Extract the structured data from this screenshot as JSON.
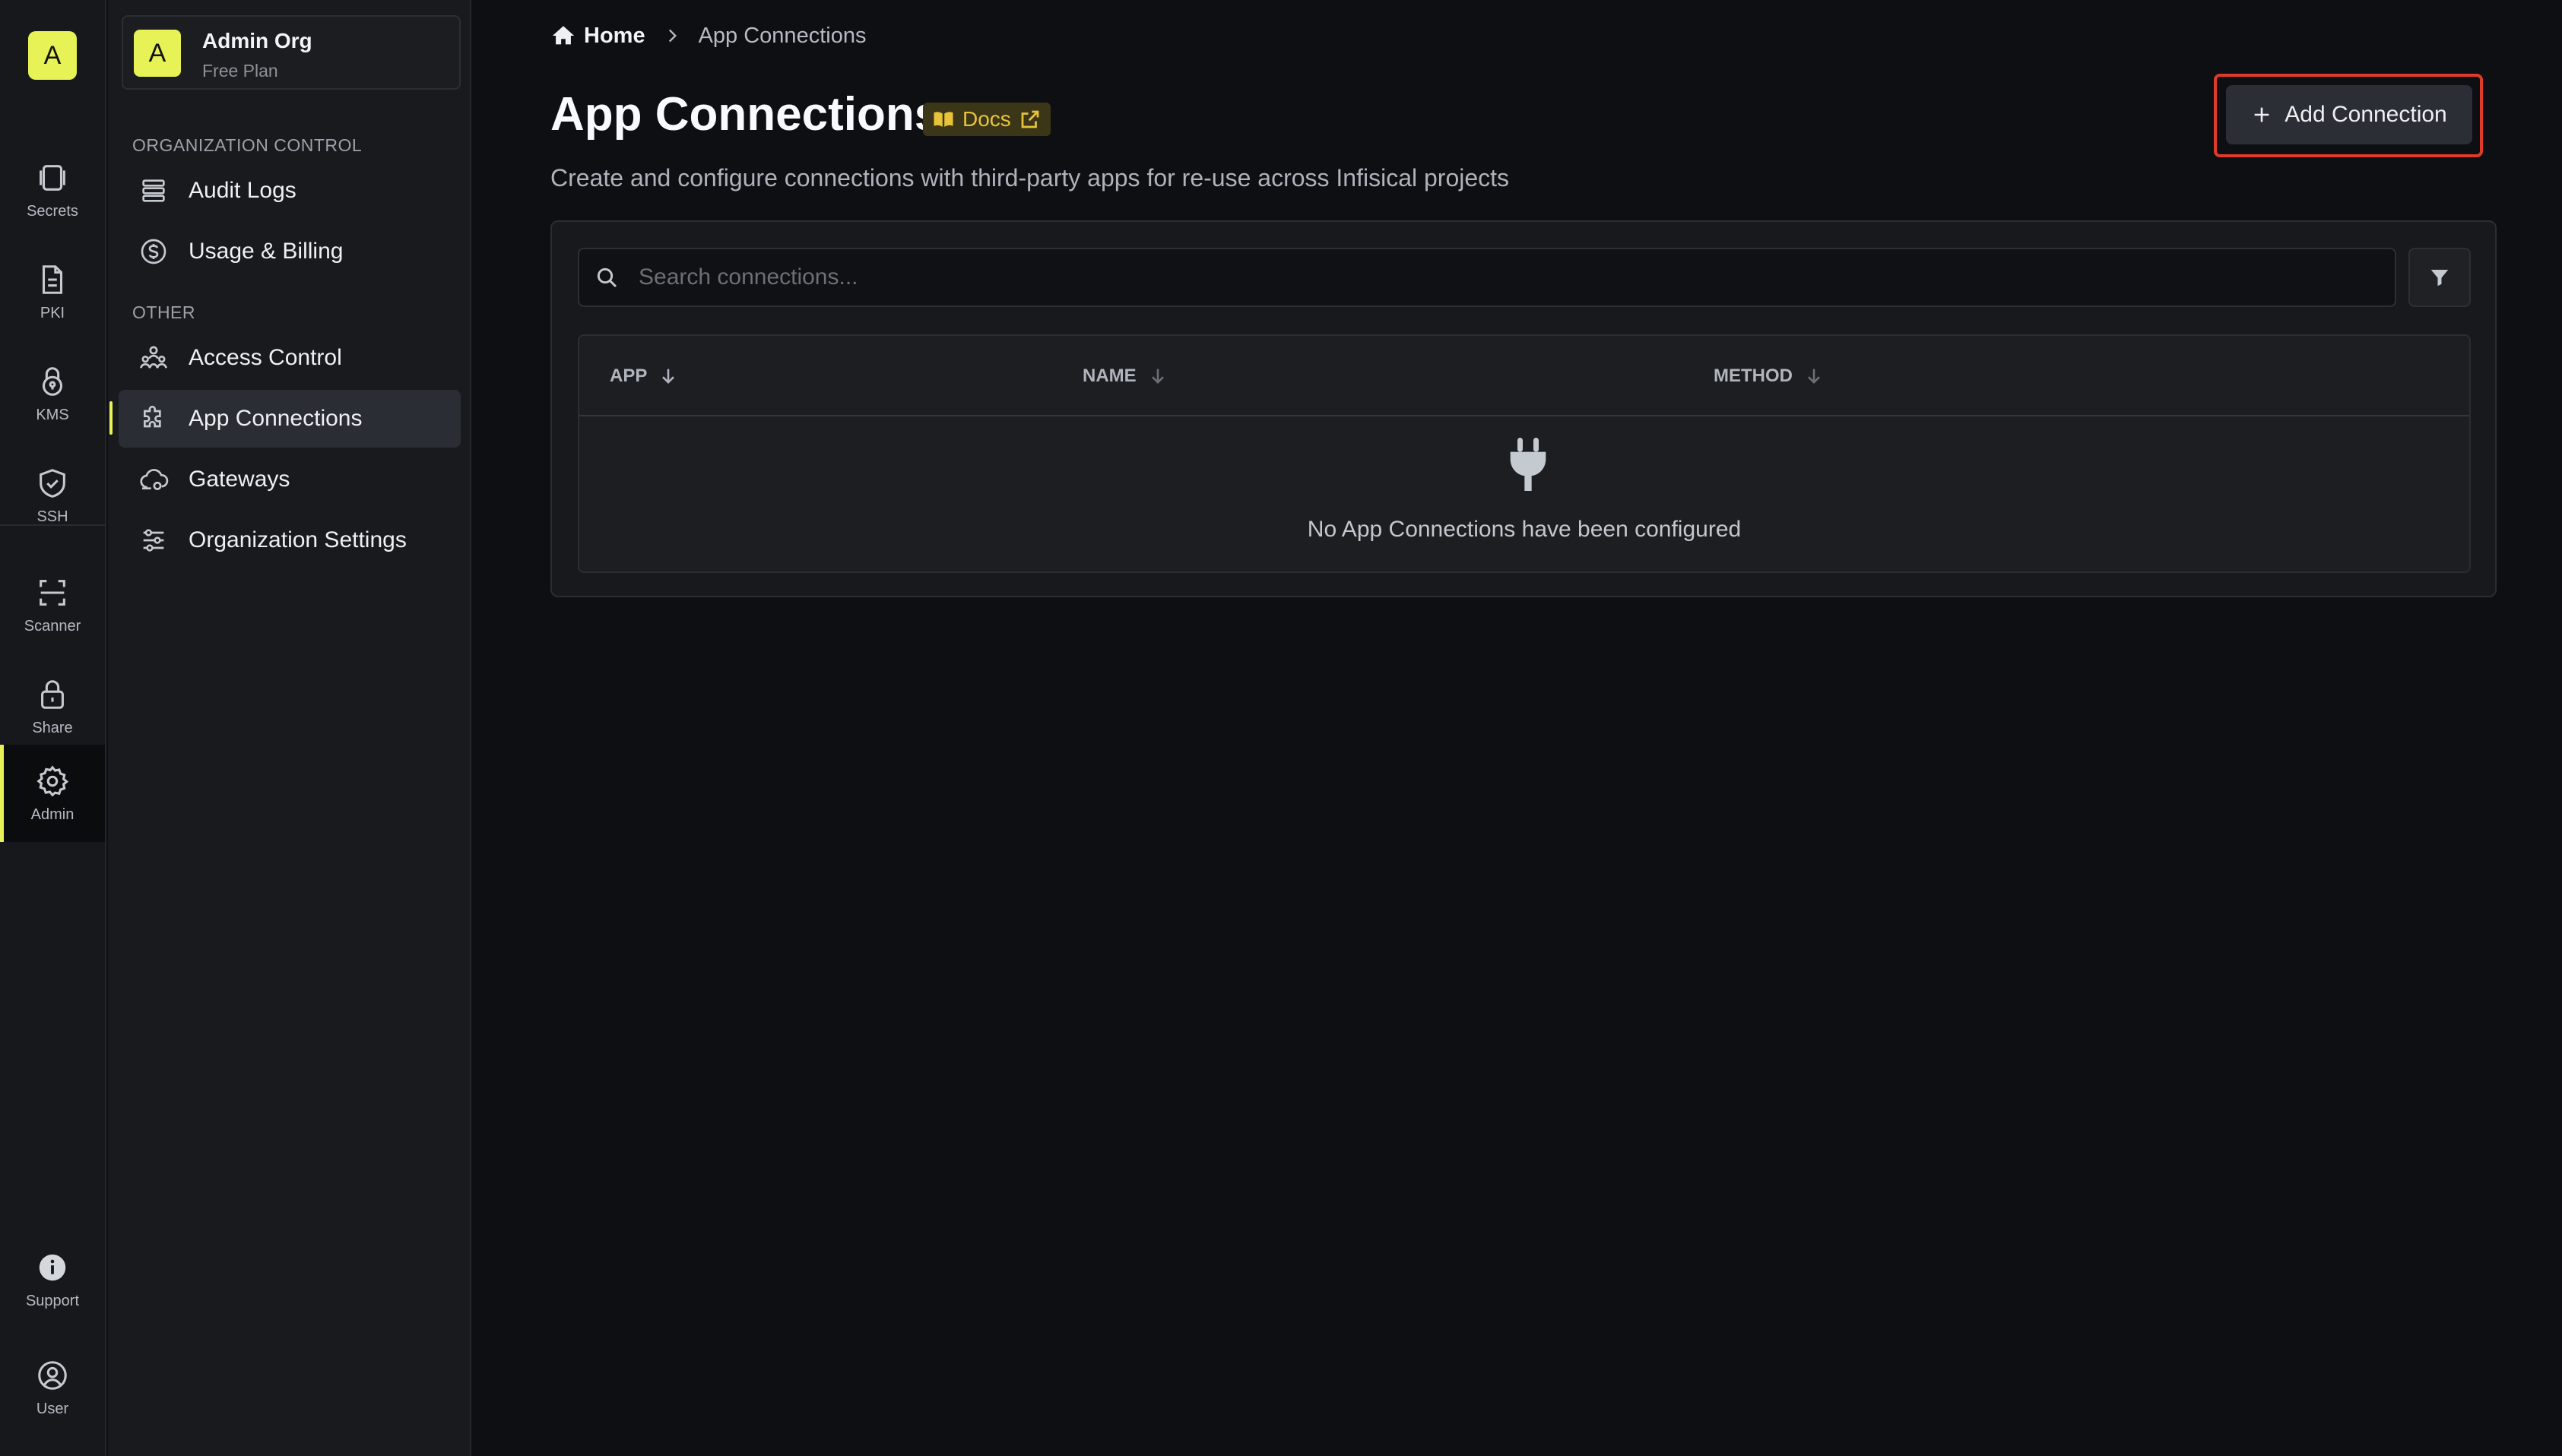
{
  "rail": {
    "logo_letter": "A",
    "items": [
      {
        "label": "Secrets",
        "icon": "secrets-icon"
      },
      {
        "label": "PKI",
        "icon": "document-icon"
      },
      {
        "label": "KMS",
        "icon": "lock-key-icon"
      },
      {
        "label": "SSH",
        "icon": "shield-check-icon"
      },
      {
        "label": "Scanner",
        "icon": "scan-icon"
      },
      {
        "label": "Share",
        "icon": "lock-icon"
      },
      {
        "label": "Admin",
        "icon": "gear-icon"
      },
      {
        "label": "Support",
        "icon": "info-icon"
      },
      {
        "label": "User",
        "icon": "user-circle-icon"
      }
    ],
    "active": "Admin",
    "accent_color": "#e7f256"
  },
  "sidebar": {
    "org": {
      "avatar_letter": "A",
      "name": "Admin Org",
      "plan": "Free Plan"
    },
    "sections": [
      {
        "label": "ORGANIZATION CONTROL",
        "items": [
          {
            "label": "Audit Logs",
            "icon": "list-icon"
          },
          {
            "label": "Usage & Billing",
            "icon": "dollar-circle-icon"
          }
        ]
      },
      {
        "label": "OTHER",
        "items": [
          {
            "label": "Access Control",
            "icon": "users-icon"
          },
          {
            "label": "App Connections",
            "icon": "puzzle-icon"
          },
          {
            "label": "Gateways",
            "icon": "cloud-icon"
          },
          {
            "label": "Organization Settings",
            "icon": "sliders-icon"
          }
        ]
      }
    ],
    "active": "App Connections"
  },
  "breadcrumb": {
    "home": "Home",
    "current": "App Connections"
  },
  "header": {
    "title": "App Connections",
    "docs_label": "Docs",
    "subtitle": "Create and configure connections with third-party apps for re-use across Infisical projects",
    "add_button": "Add Connection"
  },
  "search": {
    "placeholder": "Search connections..."
  },
  "table": {
    "columns": [
      "APP",
      "NAME",
      "METHOD"
    ],
    "empty_message": "No App Connections have been configured"
  },
  "colors": {
    "background": "#0d0f13",
    "docs_badge_text": "#e8c33a",
    "highlight_outline": "#e03a2a"
  }
}
